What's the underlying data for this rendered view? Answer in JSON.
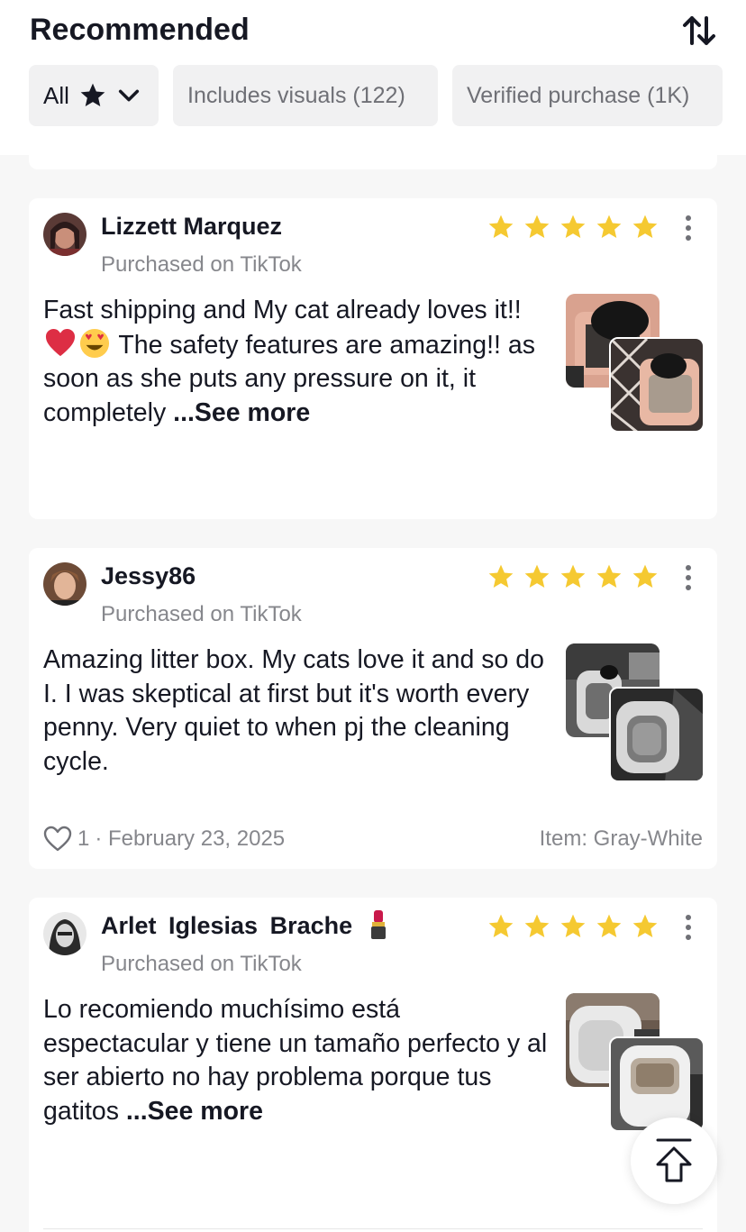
{
  "header": {
    "title": "Recommended",
    "sort_icon": "sort-arrows-icon"
  },
  "filters": {
    "all_label": "All",
    "visuals_label": "Includes visuals (122)",
    "verified_label": "Verified purchase (1K)"
  },
  "reviews": [
    {
      "name": "Lizzett Marquez",
      "source": "Purchased on TikTok",
      "rating": 5,
      "text_a": "Fast shipping and My cat already loves it!! ",
      "text_b": " The safety features are amazing!! as soon as she puts any pressure on it, it completely ",
      "see_more": "...See more",
      "emojis": [
        "red-heart-emoji",
        "heart-eyes-emoji"
      ]
    },
    {
      "name": "Jessy86",
      "source": "Purchased on TikTok",
      "rating": 5,
      "text": "Amazing litter box. My cats love it and so do I. I was skeptical at first but it's worth every penny. Very quiet to when pj the cleaning cycle.",
      "likes": "1",
      "date": "· February 23, 2025",
      "item": "Item: Gray-White"
    },
    {
      "name": "Arlet  Iglesias  Brache",
      "source": "Purchased on TikTok",
      "rating": 5,
      "text": "Lo recomiendo muchísimo está espectacular y tiene un tamaño perfecto y al ser abierto no hay problema porque tus gatitos ",
      "see_more": "...See more",
      "name_emoji": "lipstick-emoji"
    }
  ],
  "colors": {
    "star": "#f5c931",
    "muted": "#86878c",
    "chip_bg": "#f1f1f2"
  }
}
